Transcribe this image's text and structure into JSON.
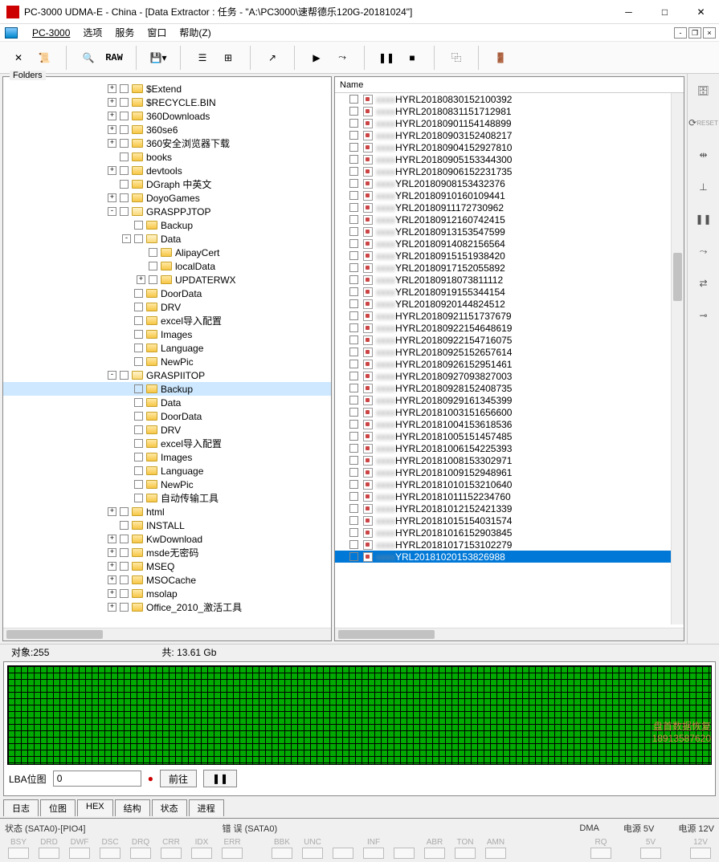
{
  "window": {
    "title": "PC-3000 UDMA-E - China - [Data Extractor : 任务 - \"A:\\PC3000\\速帮德乐120G-20181024\"]"
  },
  "menubar": {
    "items": [
      "PC-3000",
      "选项",
      "服务",
      "窗口",
      "帮助(Z)"
    ]
  },
  "toolbar": {
    "raw_label": "RAW"
  },
  "left_panel": {
    "label": "Folders",
    "tree": [
      {
        "depth": 0,
        "exp": "+",
        "name": "$Extend"
      },
      {
        "depth": 0,
        "exp": "+",
        "name": "$RECYCLE.BIN"
      },
      {
        "depth": 0,
        "exp": "+",
        "name": "360Downloads"
      },
      {
        "depth": 0,
        "exp": "+",
        "name": "360se6"
      },
      {
        "depth": 0,
        "exp": "+",
        "name": "360安全浏览器下载"
      },
      {
        "depth": 0,
        "exp": " ",
        "name": "books"
      },
      {
        "depth": 0,
        "exp": "+",
        "name": "devtools"
      },
      {
        "depth": 0,
        "exp": " ",
        "name": "DGraph 中英文"
      },
      {
        "depth": 0,
        "exp": "+",
        "name": "DoyoGames"
      },
      {
        "depth": 0,
        "exp": "-",
        "name": "GRASPPJTOP",
        "open": true
      },
      {
        "depth": 1,
        "exp": " ",
        "name": "Backup"
      },
      {
        "depth": 1,
        "exp": "-",
        "name": "Data",
        "open": true
      },
      {
        "depth": 2,
        "exp": " ",
        "name": "AlipayCert"
      },
      {
        "depth": 2,
        "exp": " ",
        "name": "localData"
      },
      {
        "depth": 2,
        "exp": "+",
        "name": "UPDATERWX"
      },
      {
        "depth": 1,
        "exp": " ",
        "name": "DoorData"
      },
      {
        "depth": 1,
        "exp": " ",
        "name": "DRV"
      },
      {
        "depth": 1,
        "exp": " ",
        "name": "excel导入配置"
      },
      {
        "depth": 1,
        "exp": " ",
        "name": "Images"
      },
      {
        "depth": 1,
        "exp": " ",
        "name": "Language"
      },
      {
        "depth": 1,
        "exp": " ",
        "name": "NewPic"
      },
      {
        "depth": 0,
        "exp": "-",
        "name": "GRASPIITOP",
        "open": true
      },
      {
        "depth": 1,
        "exp": " ",
        "name": "Backup",
        "selected": true
      },
      {
        "depth": 1,
        "exp": " ",
        "name": "Data"
      },
      {
        "depth": 1,
        "exp": " ",
        "name": "DoorData"
      },
      {
        "depth": 1,
        "exp": " ",
        "name": "DRV"
      },
      {
        "depth": 1,
        "exp": " ",
        "name": "excel导入配置"
      },
      {
        "depth": 1,
        "exp": " ",
        "name": "Images"
      },
      {
        "depth": 1,
        "exp": " ",
        "name": "Language"
      },
      {
        "depth": 1,
        "exp": " ",
        "name": "NewPic"
      },
      {
        "depth": 1,
        "exp": " ",
        "name": "自动传输工具"
      },
      {
        "depth": 0,
        "exp": "+",
        "name": "html"
      },
      {
        "depth": 0,
        "exp": " ",
        "name": "INSTALL"
      },
      {
        "depth": 0,
        "exp": "+",
        "name": "KwDownload"
      },
      {
        "depth": 0,
        "exp": "+",
        "name": "msde无密码"
      },
      {
        "depth": 0,
        "exp": "+",
        "name": "MSEQ"
      },
      {
        "depth": 0,
        "exp": "+",
        "name": "MSOCache"
      },
      {
        "depth": 0,
        "exp": "+",
        "name": "msolap"
      },
      {
        "depth": 0,
        "exp": "+",
        "name": "Office_2010_激活工具"
      }
    ]
  },
  "right_panel": {
    "header": "Name",
    "prefix_blur": "xxxx",
    "files": [
      "HYRL20180830152100392",
      "HYRL20180831151712981",
      "HYRL20180901154148899",
      "HYRL20180903152408217",
      "HYRL20180904152927810",
      "HYRL20180905153344300",
      "HYRL20180906152231735",
      "YRL20180908153432376",
      "YRL20180910160109441",
      "YRL20180911172730962",
      "YRL20180912160742415",
      "YRL20180913153547599",
      "YRL20180914082156564",
      "YRL20180915151938420",
      "YRL20180917152055892",
      "YRL20180918073811112",
      "YRL20180919155344154",
      "YRL20180920144824512",
      "HYRL20180921151737679",
      "HYRL20180922154648619",
      "HYRL20180922154716075",
      "HYRL20180925152657614",
      "HYRL20180926152951461",
      "HYRL20180927093827003",
      "HYRL20180928152408735",
      "HYRL20180929161345399",
      "HYRL20181003151656600",
      "HYRL20181004153618536",
      "HYRL20181005151457485",
      "HYRL20181006154225393",
      "HYRL20181008153302971",
      "HYRL20181009152948961",
      "HYRL20181010153210640",
      "HYRL20181011152234760",
      "HYRL20181012152421339",
      "HYRL20181015154031574",
      "HYRL20181016152903845",
      "HYRL20181017153102279",
      "YRL20181020153826988"
    ],
    "selected_index": 38
  },
  "sidebar": {
    "reset_label": "RESET"
  },
  "status": {
    "objects_label": "对象:",
    "objects_value": "255",
    "total_label": "共:",
    "total_value": "13.61 Gb"
  },
  "map": {
    "label": "LBA位图",
    "input_value": "0",
    "go_label": "前往",
    "pause_icon": "❚❚"
  },
  "tabs": {
    "items": [
      "日志",
      "位图",
      "HEX",
      "结构",
      "状态",
      "进程"
    ]
  },
  "bottom": {
    "status_label": "状态 (SATA0)-[PIO4]",
    "error_label": "错 误 (SATA0)",
    "dma_label": "DMA",
    "pwr5_label": "电源 5V",
    "pwr12_label": "电源 12V",
    "leds_status": [
      "BSY",
      "DRD",
      "DWF",
      "DSC",
      "DRQ",
      "CRR",
      "IDX",
      "ERR"
    ],
    "leds_error": [
      "BBK",
      "UNC",
      "",
      "INF",
      "",
      "ABR",
      "TON",
      "AMN"
    ],
    "dma_led": "RQ",
    "pwr5_led": "5V",
    "pwr12_led": "12V"
  },
  "watermark": {
    "line1": "盘首数据恢复",
    "line2": "18913587620"
  }
}
